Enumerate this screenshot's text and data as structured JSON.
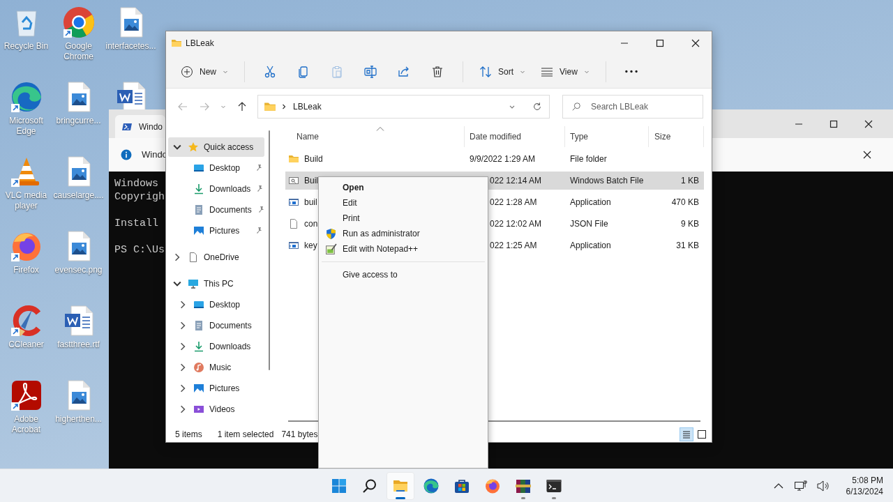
{
  "desktop": {
    "icons": [
      {
        "label": "Recycle Bin",
        "kind": "recycle-bin",
        "shortcut": false
      },
      {
        "label": "Microsoft Edge",
        "kind": "edge",
        "shortcut": true
      },
      {
        "label": "VLC media player",
        "kind": "vlc",
        "shortcut": true
      },
      {
        "label": "Firefox",
        "kind": "firefox",
        "shortcut": true
      },
      {
        "label": "CCleaner",
        "kind": "ccleaner",
        "shortcut": true
      },
      {
        "label": "Adobe Acrobat",
        "kind": "acrobat",
        "shortcut": true
      },
      {
        "label": "Google Chrome",
        "kind": "chrome",
        "shortcut": true
      },
      {
        "label": "bringcurre...",
        "kind": "image",
        "shortcut": false
      },
      {
        "label": "causelarge....",
        "kind": "image",
        "shortcut": false
      },
      {
        "label": "evensec.png",
        "kind": "image",
        "shortcut": false
      },
      {
        "label": "fastthree.rtf",
        "kind": "word",
        "shortcut": false
      },
      {
        "label": "higherthen...",
        "kind": "image",
        "shortcut": false
      },
      {
        "label": "interfacetes...",
        "kind": "image",
        "shortcut": false
      },
      {
        "kind": "word",
        "shortcut": false
      }
    ]
  },
  "terminal": {
    "tab": {
      "title": "Windo"
    },
    "notice": {
      "text": "Windo"
    },
    "paragraphs": [
      [
        "Windows",
        "Copyrigh"
      ],
      [
        "Install"
      ],
      [
        "PS C:\\Us"
      ]
    ]
  },
  "explorer": {
    "title": "LBLeak",
    "toolbar": {
      "groups": [
        [
          {
            "kind": "new",
            "label": "New",
            "menu": true,
            "disabled": false
          }
        ],
        [
          {
            "kind": "cut",
            "disabled": false
          },
          {
            "kind": "copy",
            "disabled": false
          },
          {
            "kind": "paste",
            "disabled": true
          },
          {
            "kind": "rename",
            "disabled": false
          },
          {
            "kind": "share",
            "disabled": false
          },
          {
            "kind": "delete",
            "disabled": false
          }
        ],
        [
          {
            "kind": "sort",
            "label": "Sort",
            "menu": true,
            "disabled": false
          },
          {
            "kind": "view",
            "label": "View",
            "menu": true,
            "disabled": false
          }
        ],
        [
          {
            "kind": "more",
            "disabled": false
          }
        ]
      ]
    },
    "navigation": {
      "back_disabled": true,
      "forward_disabled": true,
      "up_disabled": false
    },
    "address": {
      "path": [
        "LBLeak"
      ]
    },
    "search": {
      "placeholder": "Search LBLeak"
    },
    "nav_pane": [
      {
        "label": "Quick access",
        "kind": "quick-access",
        "expanded": true,
        "selected": true,
        "children": [
          {
            "label": "Desktop",
            "kind": "desktop",
            "pinned": true,
            "selected": false
          },
          {
            "label": "Downloads",
            "kind": "downloads",
            "pinned": true,
            "selected": false
          },
          {
            "label": "Documents",
            "kind": "documents",
            "pinned": true,
            "selected": false
          },
          {
            "label": "Pictures",
            "kind": "pictures",
            "pinned": true,
            "selected": false
          }
        ]
      },
      {
        "label": "OneDrive",
        "kind": "onedrive",
        "expanded": false,
        "selected": false
      },
      {
        "label": "This PC",
        "kind": "pc",
        "expanded": true,
        "selected": false,
        "children": [
          {
            "label": "Desktop",
            "kind": "desktop",
            "expanded": false,
            "selected": false
          },
          {
            "label": "Documents",
            "kind": "documents",
            "expanded": false,
            "selected": false
          },
          {
            "label": "Downloads",
            "kind": "downloads",
            "expanded": false,
            "selected": false
          },
          {
            "label": "Music",
            "kind": "music",
            "expanded": false,
            "selected": false
          },
          {
            "label": "Pictures",
            "kind": "pictures",
            "expanded": false,
            "selected": false
          },
          {
            "label": "Videos",
            "kind": "videos",
            "expanded": false,
            "selected": false
          }
        ]
      }
    ],
    "columns": [
      {
        "label": "Name",
        "sorted": true
      },
      {
        "label": "Date modified",
        "sorted": false
      },
      {
        "label": "Type",
        "sorted": false
      },
      {
        "label": "Size",
        "sorted": false
      }
    ],
    "rows": [
      {
        "kind": "folder",
        "name": "Build",
        "date": "9/9/2022 1:29 AM",
        "type": "File folder",
        "selected": false
      },
      {
        "kind": "batch",
        "name": "Buil",
        "date": "022 12:14 AM",
        "type": "Windows Batch File",
        "size": "1 KB",
        "selected": true
      },
      {
        "kind": "application",
        "name": "buil",
        "date": "022 1:28 AM",
        "type": "Application",
        "size": "470 KB",
        "selected": false
      },
      {
        "kind": "json",
        "name": "con",
        "date": "022 12:02 AM",
        "type": "JSON File",
        "size": "9 KB",
        "selected": false
      },
      {
        "kind": "application",
        "name": "key",
        "date": "022 1:25 AM",
        "type": "Application",
        "size": "31 KB",
        "selected": false
      }
    ],
    "status": {
      "count": "5 items",
      "selection": "1 item selected",
      "size": "741 bytes",
      "view_modes": [
        {
          "kind": "details",
          "selected": true
        },
        {
          "kind": "tiles",
          "selected": false
        }
      ]
    }
  },
  "context_menu": {
    "groups": [
      [
        {
          "label": "Open",
          "kind": "plain",
          "default": true
        },
        {
          "label": "Edit",
          "kind": "plain",
          "default": false
        },
        {
          "label": "Print",
          "kind": "plain",
          "default": false
        },
        {
          "label": "Run as administrator",
          "kind": "shield",
          "default": false
        },
        {
          "label": "Edit with Notepad++",
          "kind": "notepad",
          "default": false
        }
      ],
      [
        {
          "label": "Give access to",
          "kind": "plain",
          "default": false
        }
      ]
    ]
  },
  "taskbar": {
    "items": [
      {
        "kind": "start",
        "active": false,
        "running": false
      },
      {
        "kind": "search",
        "active": false,
        "running": false
      },
      {
        "kind": "explorer",
        "active": true,
        "running": true
      },
      {
        "kind": "edge",
        "active": false,
        "running": false
      },
      {
        "kind": "store",
        "active": false,
        "running": false
      },
      {
        "kind": "firefox",
        "active": false,
        "running": false
      },
      {
        "kind": "archiver",
        "active": false,
        "running": true
      },
      {
        "kind": "terminal",
        "active": false,
        "running": true
      }
    ],
    "clock": {
      "time": "5:08 PM",
      "date": "6/13/2024"
    }
  }
}
